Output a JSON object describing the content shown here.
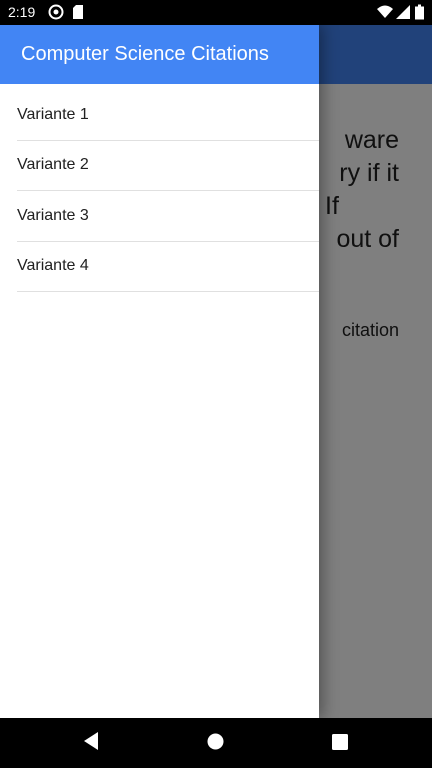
{
  "status_bar": {
    "time": "2:19",
    "left_icons": [
      "sync-icon",
      "sd-card-icon"
    ],
    "right_icons": [
      "wifi-icon",
      "cellular-signal-icon",
      "battery-icon"
    ]
  },
  "background_screen": {
    "citation_lines": [
      "ware",
      "ry if it",
      "If",
      "out of"
    ],
    "meta_fragment": "citation"
  },
  "drawer": {
    "title": "Computer Science Citations",
    "items": [
      {
        "label": "Variante 1"
      },
      {
        "label": "Variante 2"
      },
      {
        "label": "Variante 3"
      },
      {
        "label": "Variante 4"
      }
    ]
  },
  "nav_bar": {
    "buttons": [
      "back-icon",
      "home-icon",
      "recents-icon"
    ]
  },
  "colors": {
    "primary": "#4285f4",
    "scrim": "rgba(0,0,0,0.5)"
  }
}
